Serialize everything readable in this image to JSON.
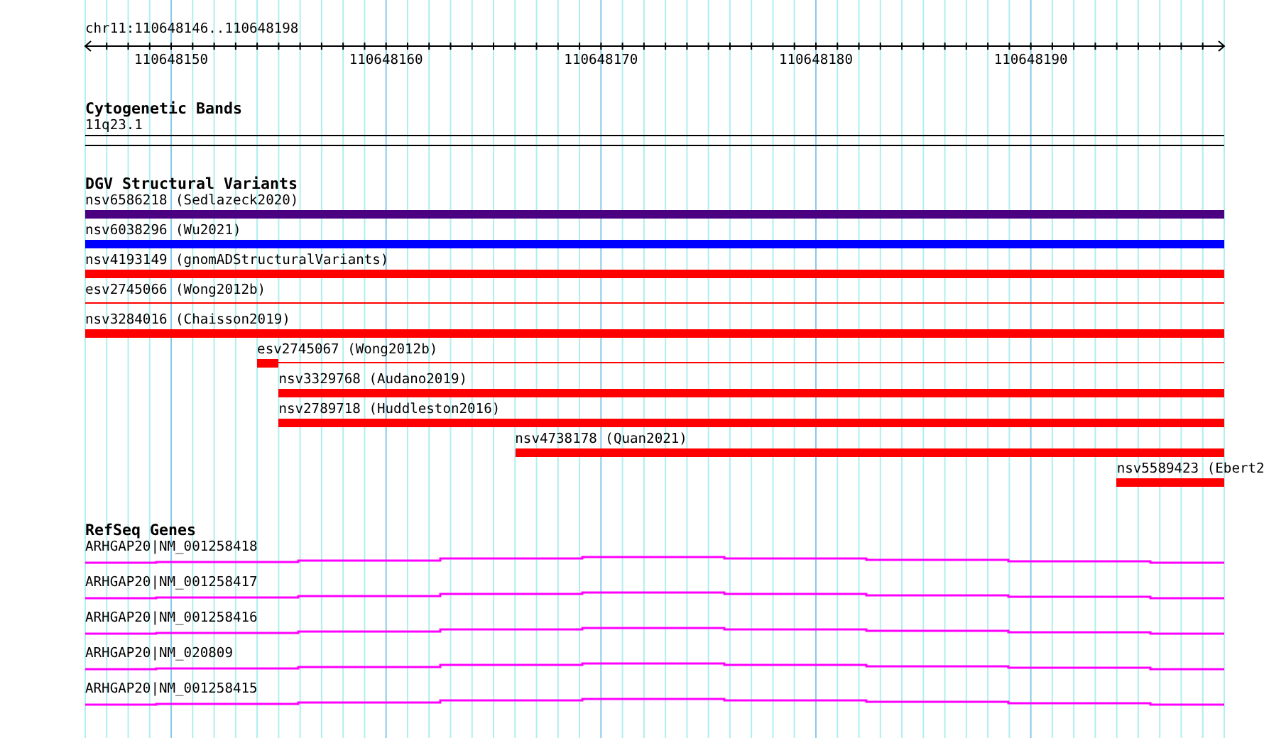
{
  "location": "chr11:110648146..110648198",
  "ruler": {
    "ticks": [
      "110648150",
      "110648160",
      "110648170",
      "110648180",
      "110648190"
    ]
  },
  "tracks": [
    {
      "kind": "bands",
      "title": "Cytogenetic Bands",
      "features": [
        {
          "label": "11q23.1"
        }
      ]
    },
    {
      "kind": "variants",
      "title": "DGV Structural Variants",
      "features": [
        {
          "label": "nsv6586218 (Sedlazeck2020)",
          "kind": "thick",
          "color": "#4b0082"
        },
        {
          "label": "nsv6038296 (Wu2021)",
          "kind": "thick",
          "color": "#0000ff"
        },
        {
          "label": "nsv4193149 (gnomADStructuralVariants)",
          "kind": "thick",
          "color": "#ff0000"
        },
        {
          "label": "esv2745066 (Wong2012b)",
          "kind": "thin",
          "color": "#ff0000"
        },
        {
          "label": "nsv3284016 (Chaisson2019)",
          "kind": "thick",
          "color": "#ff0000"
        },
        {
          "label": "esv2745067 (Wong2012b)",
          "kind": "split",
          "color": "#ff0000"
        },
        {
          "label": "nsv3329768 (Audano2019)",
          "kind": "thick",
          "color": "#ff0000"
        },
        {
          "label": "nsv2789718 (Huddleston2016)",
          "kind": "thick",
          "color": "#ff0000"
        },
        {
          "label": "nsv4738178 (Quan2021)",
          "kind": "thick",
          "color": "#ff0000"
        },
        {
          "label": "nsv5589423 (Ebert2",
          "kind": "thick",
          "color": "#ff0000"
        }
      ]
    },
    {
      "kind": "genes",
      "title": "RefSeq Genes",
      "features": [
        {
          "label": "ARHGAP20|NM_001258418"
        },
        {
          "label": "ARHGAP20|NM_001258417"
        },
        {
          "label": "ARHGAP20|NM_001258416"
        },
        {
          "label": "ARHGAP20|NM_020809"
        },
        {
          "label": "ARHGAP20|NM_001258415"
        }
      ]
    }
  ]
}
